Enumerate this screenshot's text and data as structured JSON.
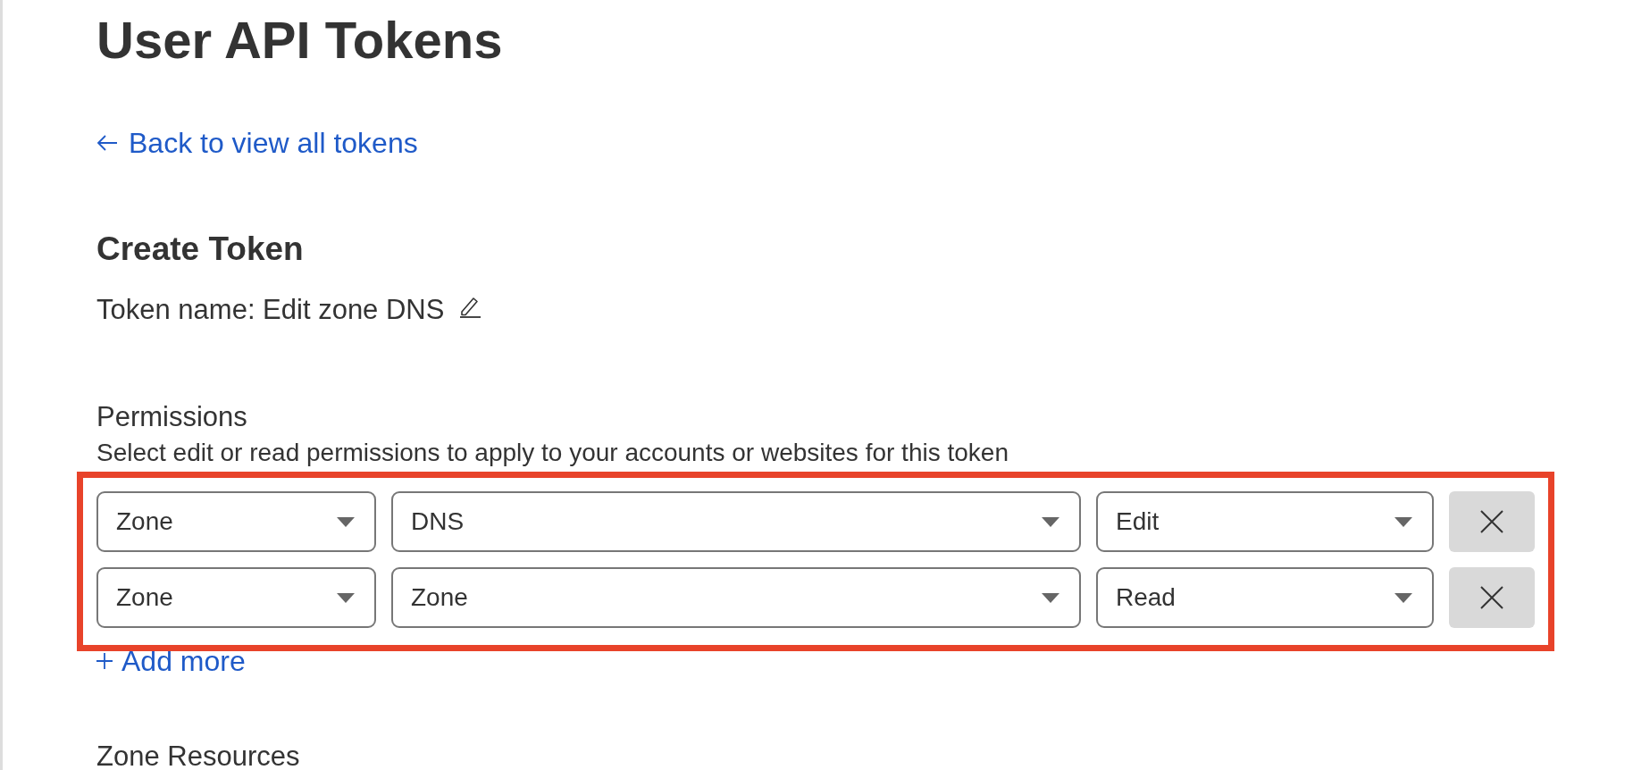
{
  "page_title": "User API Tokens",
  "back_link": "Back to view all tokens",
  "section_title": "Create Token",
  "token_name": "Token name: Edit zone DNS",
  "permissions": {
    "label": "Permissions",
    "description": "Select edit or read permissions to apply to your accounts or websites for this token",
    "highlighted": true,
    "rows": [
      {
        "scope": "Zone",
        "resource": "DNS",
        "access": "Edit"
      },
      {
        "scope": "Zone",
        "resource": "Zone",
        "access": "Read"
      }
    ],
    "add_more": "Add more"
  },
  "zone_resources": {
    "label": "Zone Resources"
  }
}
